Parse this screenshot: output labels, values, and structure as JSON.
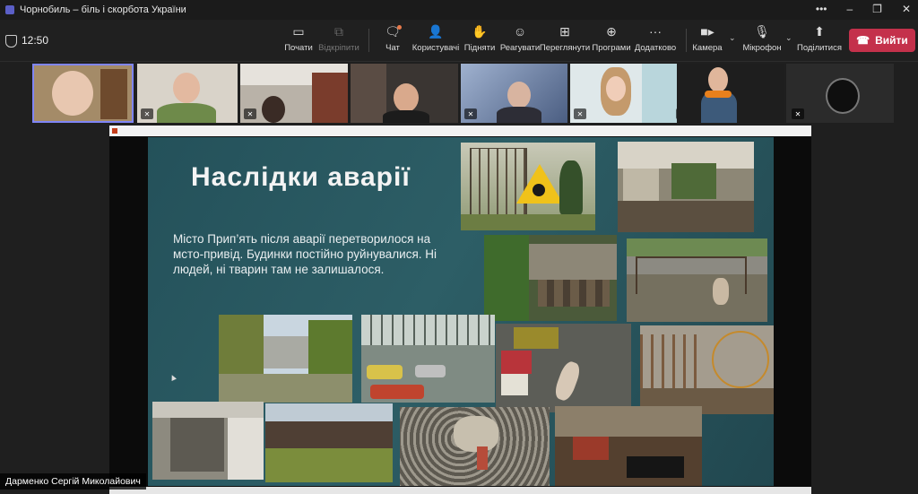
{
  "window": {
    "title": "Чорнобиль – біль і скорбота України",
    "controls": {
      "more": "•••",
      "minimize": "–",
      "restore": "❐",
      "close": "✕"
    }
  },
  "meeting": {
    "elapsed": "12:50",
    "toolbar": {
      "view_label": "Почати",
      "popout_label": "Відкріпити",
      "chat_label": "Чат",
      "people_label": "Користувачі",
      "raise_label": "Підняти",
      "react_label": "Реагувати",
      "rooms_label": "Переглянути",
      "apps_label": "Програми",
      "more_label": "Додатково",
      "camera_label": "Камера",
      "mic_label": "Мікрофон",
      "share_label": "Поділитися",
      "leave_label": "Вийти"
    },
    "presenter_name": "Дарменко Сергій Миколайович"
  },
  "slide": {
    "title": "Наслідки аварії",
    "body": "Місто Прип’ять після аварії  перетворилося на мсто-привід. Будинки постійно руйнувалися. Ні людей, ні тварин там не залишалося."
  },
  "icons": {
    "chat": "chat-icon",
    "people": "people-icon",
    "raise": "hand-icon",
    "react": "smile-icon",
    "rooms": "grid-icon",
    "apps": "plus-icon",
    "more": "more-icon",
    "camera": "camera-icon",
    "mic": "mic-off-icon",
    "share": "share-icon",
    "leave": "phone-icon"
  },
  "colors": {
    "leave_button": "#c4314b",
    "accent": "#7f85f5",
    "slide_bg": "#2d5e66"
  }
}
